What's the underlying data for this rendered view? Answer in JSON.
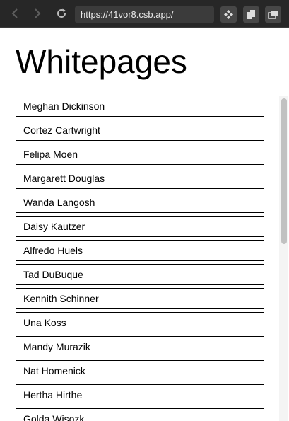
{
  "browser": {
    "url": "https://41vor8.csb.app/",
    "back_icon": "chevron-left-icon",
    "forward_icon": "chevron-right-icon",
    "reload_icon": "reload-icon"
  },
  "page": {
    "title": "Whitepages",
    "people": [
      "Meghan Dickinson",
      "Cortez Cartwright",
      "Felipa Moen",
      "Margarett Douglas",
      "Wanda Langosh",
      "Daisy Kautzer",
      "Alfredo Huels",
      "Tad DuBuque",
      "Kennith Schinner",
      "Una Koss",
      "Mandy Murazik",
      "Nat Homenick",
      "Hertha Hirthe",
      "Golda Wisozk"
    ]
  },
  "colors": {
    "toolbar_bg": "#272727",
    "page_bg": "#ffffff",
    "item_border": "#000000"
  }
}
